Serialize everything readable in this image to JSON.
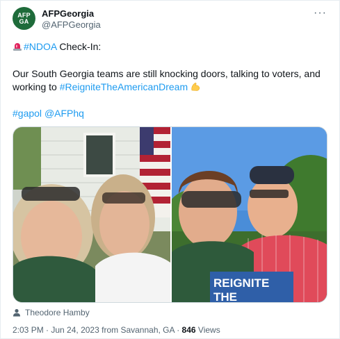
{
  "account": {
    "name": "AFPGeorgia",
    "handle": "@AFPGeorgia",
    "avatar_text_top": "AFP",
    "avatar_text_bottom": "GA",
    "avatar_color": "#1e6b3a"
  },
  "menu": {
    "more_label": "···"
  },
  "tweet": {
    "line1_hashtag": "#NDOA",
    "line1_text": " Check-In:",
    "line2": "Our South Georgia teams are still knocking doors, talking to voters, and",
    "line3_text": "working to ",
    "line3_hashtag": "#ReigniteTheAmericanDream",
    "line4_hashtag": "#gapol",
    "line4_mention": "@AFPhq",
    "link_color": "#1d9bf0"
  },
  "media": {
    "photo_right_banner_text1": "REIGNITE",
    "photo_right_banner_text2": "THE"
  },
  "tagged_user": "Theodore Hamby",
  "meta": {
    "time": "2:03 PM",
    "date": "Jun 24, 2023",
    "location": "from Savannah, GA",
    "views_count": "846",
    "views_label": "Views"
  }
}
